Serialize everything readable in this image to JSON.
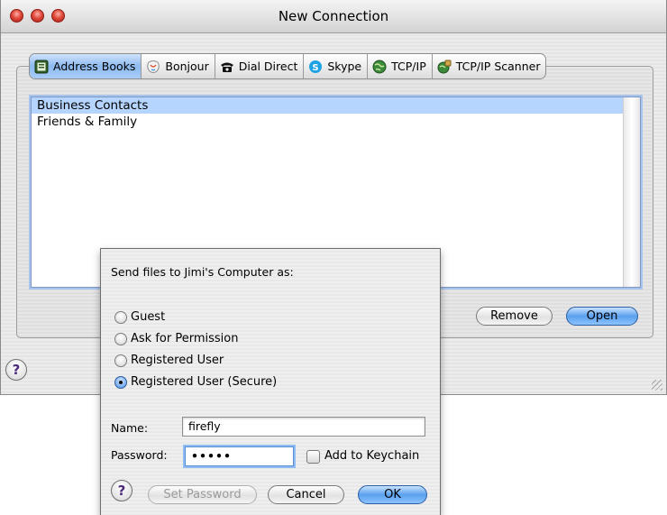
{
  "window": {
    "title": "New Connection"
  },
  "tabs": [
    {
      "label": "Address Books",
      "icon": "address-book-icon",
      "selected": true
    },
    {
      "label": "Bonjour",
      "icon": "bonjour-icon",
      "selected": false
    },
    {
      "label": "Dial Direct",
      "icon": "telephone-icon",
      "selected": false
    },
    {
      "label": "Skype",
      "icon": "skype-icon",
      "selected": false
    },
    {
      "label": "TCP/IP",
      "icon": "globe-icon",
      "selected": false
    },
    {
      "label": "TCP/IP Scanner",
      "icon": "scanner-globe-icon",
      "selected": false
    }
  ],
  "list": {
    "items": [
      {
        "label": "Business Contacts",
        "selected": true
      },
      {
        "label": "Friends & Family",
        "selected": false
      }
    ]
  },
  "buttons": {
    "remove": "Remove",
    "open": "Open"
  },
  "sheet": {
    "prompt": "Send files to Jimi's Computer as:",
    "options": [
      {
        "label": "Guest",
        "selected": false
      },
      {
        "label": "Ask for Permission",
        "selected": false
      },
      {
        "label": "Registered User",
        "selected": false
      },
      {
        "label": "Registered User (Secure)",
        "selected": true
      }
    ],
    "name_label": "Name:",
    "name_value": "firefly",
    "password_label": "Password:",
    "password_value": "•••••",
    "keychain_label": "Add to Keychain",
    "keychain_checked": false,
    "set_password": "Set Password",
    "cancel": "Cancel",
    "ok": "OK"
  },
  "colors": {
    "selection": "#b5d4fe",
    "default_button": "#5aa0ee"
  }
}
